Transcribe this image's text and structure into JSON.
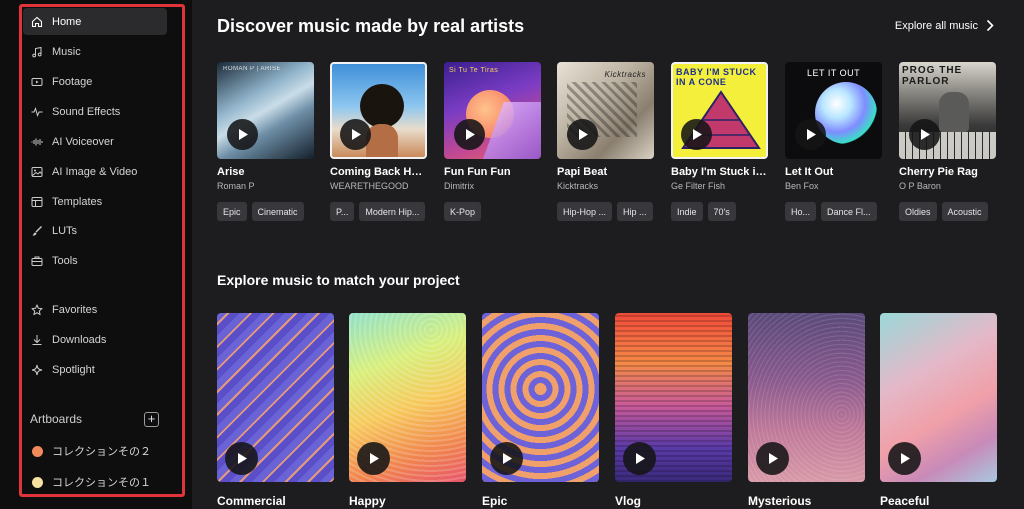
{
  "sidebar": {
    "items": [
      {
        "label": "Home",
        "icon": "home-icon",
        "active": true
      },
      {
        "label": "Music",
        "icon": "music-note-icon"
      },
      {
        "label": "Footage",
        "icon": "video-icon"
      },
      {
        "label": "Sound Effects",
        "icon": "waveform-icon"
      },
      {
        "label": "AI Voiceover",
        "icon": "voice-wave-icon"
      },
      {
        "label": "AI Image & Video",
        "icon": "image-icon"
      },
      {
        "label": "Templates",
        "icon": "template-icon"
      },
      {
        "label": "LUTs",
        "icon": "brush-icon"
      },
      {
        "label": "Tools",
        "icon": "toolbox-icon"
      },
      {
        "label": "Favorites",
        "icon": "star-icon"
      },
      {
        "label": "Downloads",
        "icon": "download-icon"
      },
      {
        "label": "Spotlight",
        "icon": "spotlight-icon"
      }
    ],
    "artboards_title": "Artboards",
    "add_label": "+",
    "artboards": [
      {
        "label": "コレクションその２",
        "color": "#f08a5d"
      },
      {
        "label": "コレクションその１",
        "color": "#f7e3a1"
      }
    ],
    "highlight_color": "#e0333a"
  },
  "discover": {
    "title": "Discover music made by real artists",
    "explore_all": "Explore all music",
    "cards": [
      {
        "title": "Arise",
        "artist": "Roman P",
        "tags": [
          "Epic",
          "Cinematic"
        ],
        "cover_text": "ROMAN P | ARISE"
      },
      {
        "title": "Coming Back Ho...",
        "artist": "WEARETHEGOOD",
        "tags": [
          "P...",
          "Modern Hip..."
        ],
        "cover_text": ""
      },
      {
        "title": "Fun Fun Fun",
        "artist": "Dimitrix",
        "tags": [
          "K-Pop"
        ],
        "cover_text": "Si Tu Te Tiras"
      },
      {
        "title": "Papi Beat",
        "artist": "Kicktracks",
        "tags": [
          "Hip-Hop ...",
          "Hip ..."
        ],
        "cover_text": "Kicktracks"
      },
      {
        "title": "Baby I'm Stuck in ...",
        "artist": "Ge Filter Fish",
        "tags": [
          "Indie",
          "70's"
        ],
        "cover_text": "BABY I'M STUCK IN A CONE"
      },
      {
        "title": "Let It Out",
        "artist": "Ben Fox",
        "tags": [
          "Ho...",
          "Dance Fl..."
        ],
        "cover_text": "LET IT OUT"
      },
      {
        "title": "Cherry Pie Rag",
        "artist": "O P Baron",
        "tags": [
          "Oldies",
          "Acoustic"
        ],
        "cover_text": "PROG THE PARLOR"
      }
    ]
  },
  "explore": {
    "title": "Explore music to match your project",
    "moods": [
      {
        "label": "Commercial"
      },
      {
        "label": "Happy"
      },
      {
        "label": "Epic"
      },
      {
        "label": "Vlog"
      },
      {
        "label": "Mysterious"
      },
      {
        "label": "Peaceful"
      }
    ]
  }
}
